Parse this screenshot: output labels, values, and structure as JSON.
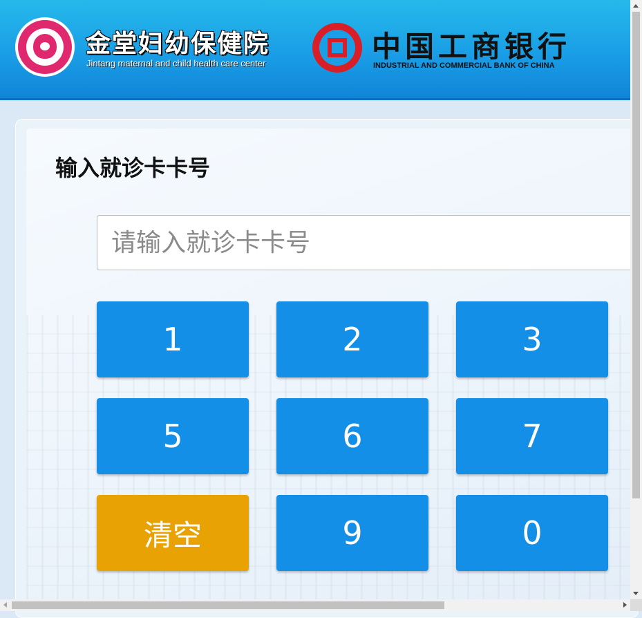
{
  "header": {
    "hospital_name": "金堂妇幼保健院",
    "hospital_name_en": "Jintang maternal and child health care center",
    "bank_name": "中国工商银行",
    "bank_name_en": "INDUSTRIAL AND COMMERCIAL BANK OF CHINA"
  },
  "main": {
    "title": "输入就诊卡卡号",
    "card_input": {
      "value": "",
      "placeholder": "请输入就诊卡卡号"
    },
    "keypad": {
      "key_1": "1",
      "key_2": "2",
      "key_3": "3",
      "key_5": "5",
      "key_6": "6",
      "key_7": "7",
      "key_clear": "清空",
      "key_9": "9",
      "key_0": "0"
    }
  },
  "colors": {
    "header_blue": "#1a9ee6",
    "key_blue": "#148fe7",
    "key_clear_orange": "#e8a203",
    "hospital_pink": "#e0286f",
    "bank_red": "#d81e26"
  },
  "icons": {
    "hospital_logo": "hospital-logo-icon",
    "bank_logo": "icbc-logo-icon"
  }
}
